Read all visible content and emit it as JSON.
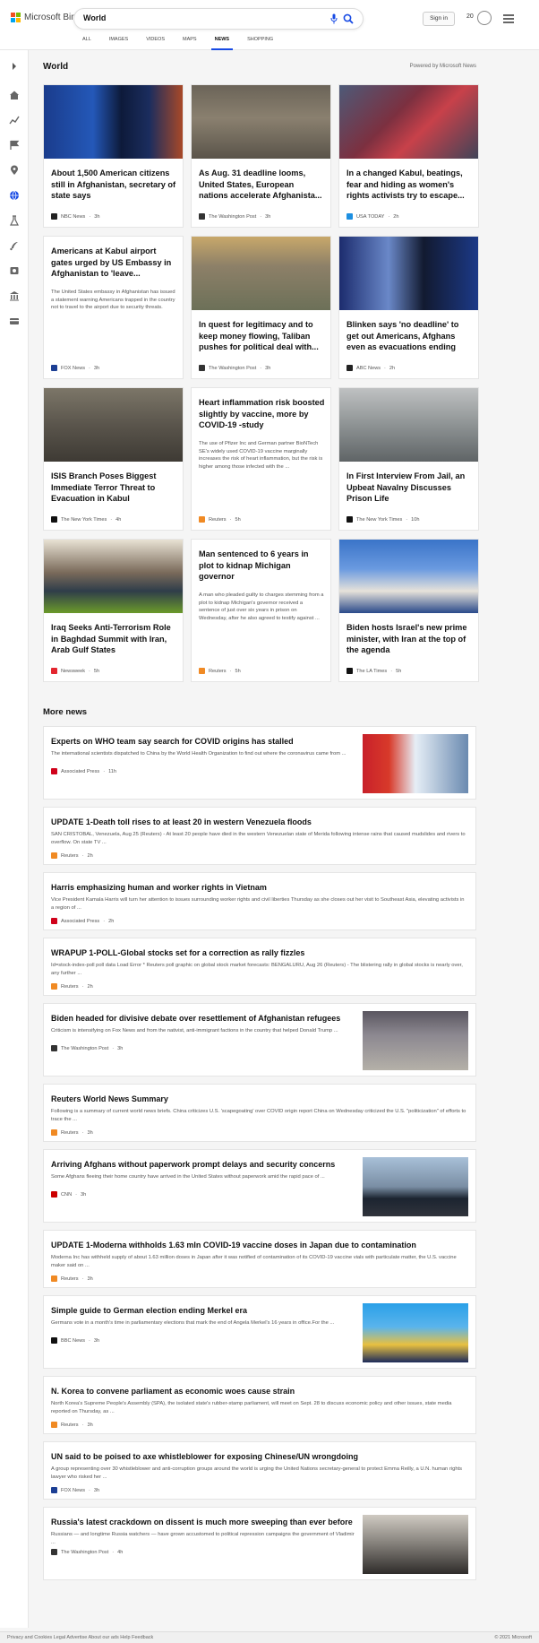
{
  "header": {
    "brand": "Microsoft Bing",
    "query": "World",
    "sign_in": "Sign in",
    "points": "20"
  },
  "tabs": [
    "ALL",
    "IMAGES",
    "VIDEOS",
    "MAPS",
    "NEWS",
    "SHOPPING"
  ],
  "active_tab": "NEWS",
  "section": {
    "title": "World",
    "powered_by": "Powered by Microsoft News"
  },
  "cards": [
    {
      "title": "About 1,500 American citizens still in Afghanistan, secretary of state says",
      "summary": "",
      "source": "NBC News",
      "time": "3h",
      "has_image": true,
      "src_color": "#222"
    },
    {
      "title": "As Aug. 31 deadline looms, United States, European nations accelerate Afghanista...",
      "summary": "",
      "source": "The Washington Post",
      "time": "3h",
      "has_image": true,
      "src_color": "#333"
    },
    {
      "title": "In a changed Kabul, beatings, fear and hiding as women's rights activists try to escape...",
      "summary": "",
      "source": "USA TODAY",
      "time": "2h",
      "has_image": true,
      "src_color": "#1d8fe1"
    },
    {
      "title": "Americans at Kabul airport gates urged by US Embassy in Afghanistan to 'leave...",
      "summary": "The United States embassy in Afghanistan has issued a statement warning Americans trapped in the country not to travel to the airport due to security threats.",
      "source": "FOX News",
      "time": "3h",
      "has_image": false,
      "src_color": "#1c3f94"
    },
    {
      "title": "In quest for legitimacy and to keep money flowing, Taliban pushes for political deal with...",
      "summary": "",
      "source": "The Washington Post",
      "time": "3h",
      "has_image": true,
      "src_color": "#333"
    },
    {
      "title": "Blinken says 'no deadline' to get out Americans, Afghans even as evacuations ending",
      "summary": "",
      "source": "ABC News",
      "time": "2h",
      "has_image": true,
      "src_color": "#222"
    },
    {
      "title": "ISIS Branch Poses Biggest Immediate Terror Threat to Evacuation in Kabul",
      "summary": "",
      "source": "The New York Times",
      "time": "4h",
      "has_image": true,
      "src_color": "#111"
    },
    {
      "title": "Heart inflammation risk boosted slightly by vaccine, more by COVID-19 -study",
      "summary": "The use of Pfizer Inc and German partner BioNTech SE's widely used COVID-19 vaccine marginally increases the risk of heart inflammation, but the risk is higher among those infected with the ...",
      "source": "Reuters",
      "time": "5h",
      "has_image": false,
      "src_color": "#f08a24"
    },
    {
      "title": "In First Interview From Jail, an Upbeat Navalny Discusses Prison Life",
      "summary": "",
      "source": "The New York Times",
      "time": "10h",
      "has_image": true,
      "src_color": "#111"
    },
    {
      "title": "Iraq Seeks Anti-Terrorism Role in Baghdad Summit with Iran, Arab Gulf States",
      "summary": "",
      "source": "Newsweek",
      "time": "5h",
      "has_image": true,
      "src_color": "#e3262f"
    },
    {
      "title": "Man sentenced to 6 years in plot to kidnap Michigan governor",
      "summary": "A man who pleaded guilty to charges stemming from a plot to kidnap Michigan's governor received a sentence of just over six years in prison on Wednesday, after he also agreed to testify against ...",
      "source": "Reuters",
      "time": "5h",
      "has_image": false,
      "src_color": "#f08a24"
    },
    {
      "title": "Biden hosts Israel's new prime minister, with Iran at the top of the agenda",
      "summary": "",
      "source": "The LA Times",
      "time": "5h",
      "has_image": true,
      "src_color": "#111"
    }
  ],
  "more_news": {
    "title": "More news",
    "items": [
      {
        "title": "Experts on WHO team say search for COVID origins has stalled",
        "summary": "The international scientists dispatched to China by the World Health Organization to find out where the coronavirus came from ...",
        "source": "Associated Press",
        "time": "11h",
        "has_image": true,
        "src_color": "#d0021b"
      },
      {
        "title": "UPDATE 1-Death toll rises to at least 20 in western Venezuela floods",
        "summary": "SAN CRISTOBAL, Venezuela, Aug 25 (Reuters) - At least 20 people have died in the western Venezuelan state of Merida following intense rains that caused mudslides and rivers to overflow. On state TV ...",
        "source": "Reuters",
        "time": "2h",
        "has_image": false,
        "src_color": "#f08a24"
      },
      {
        "title": "Harris emphasizing human and worker rights in Vietnam",
        "summary": "Vice President Kamala Harris will turn her attention to issues surrounding worker rights and civil liberties Thursday as she closes out her visit to Southeast Asia, elevating activists in a region of ...",
        "source": "Associated Press",
        "time": "2h",
        "has_image": false,
        "src_color": "#d0021b"
      },
      {
        "title": "WRAPUP 1-POLL-Global stocks set for a correction as rally fizzles",
        "summary": "Id=stock-index-poll poll data Load Error * Reuters poll graphic on global stock market forecasts: BENGALURU, Aug 26 (Reuters) - The blistering rally in global stocks is nearly over, any further ...",
        "source": "Reuters",
        "time": "2h",
        "has_image": false,
        "src_color": "#f08a24"
      },
      {
        "title": "Biden headed for divisive debate over resettlement of Afghanistan refugees",
        "summary": "Criticism is intensifying on Fox News and from the nativist, anti-immigrant factions in the country that helped Donald Trump ...",
        "source": "The Washington Post",
        "time": "3h",
        "has_image": true,
        "src_color": "#333"
      },
      {
        "title": "Reuters World News Summary",
        "summary": "Following is a summary of current world news briefs. China criticizes U.S. 'scapegoating' over COVID origin report China on Wednesday criticized the U.S. \"politicization\" of efforts to trace the ...",
        "source": "Reuters",
        "time": "3h",
        "has_image": false,
        "src_color": "#f08a24"
      },
      {
        "title": "Arriving Afghans without paperwork prompt delays and security concerns",
        "summary": "Some Afghans fleeing their home country have arrived in the United States without paperwork amid the rapid pace of ...",
        "source": "CNN",
        "time": "3h",
        "has_image": true,
        "src_color": "#cc0000"
      },
      {
        "title": "UPDATE 1-Moderna withholds 1.63 mln COVID-19 vaccine doses in Japan due to contamination",
        "summary": "Moderna Inc has withheld supply of about 1.63 million doses in Japan after it was notified of contamination of its COVID-19 vaccine vials with particulate matter, the U.S. vaccine maker said on ...",
        "source": "Reuters",
        "time": "3h",
        "has_image": false,
        "src_color": "#f08a24"
      },
      {
        "title": "Simple guide to German election ending Merkel era",
        "summary": "Germans vote in a month's time in parliamentary elections that mark the end of Angela Merkel's 16 years in office.For the ...",
        "source": "BBC News",
        "time": "3h",
        "has_image": true,
        "src_color": "#111"
      },
      {
        "title": "N. Korea to convene parliament as economic woes cause strain",
        "summary": "North Korea's Supreme People's Assembly (SPA), the isolated state's rubber-stamp parliament, will meet on Sept. 28 to discuss economic policy and other issues, state media reported on Thursday, as ...",
        "source": "Reuters",
        "time": "3h",
        "has_image": false,
        "src_color": "#f08a24"
      },
      {
        "title": "UN said to be poised to axe whistleblower for exposing Chinese/UN wrongdoing",
        "summary": "A group representing over 30 whistleblower and anti-corruption groups around the world is urging the United Nations secretary-general to protect Emma Reilly, a U.N. human rights lawyer who risked her ...",
        "source": "FOX News",
        "time": "3h",
        "has_image": false,
        "src_color": "#1c3f94"
      },
      {
        "title": "Russia's latest crackdown on dissent is much more sweeping than ever before",
        "summary": "Russians — and longtime Russia watchers — have grown accustomed to political repression campaigns the government of Vladimir ...",
        "source": "The Washington Post",
        "time": "4h",
        "has_image": true,
        "src_color": "#333"
      }
    ]
  },
  "footer": {
    "left": "Privacy and Cookies  Legal  Advertise  About our ads  Help  Feedback",
    "right": "© 2021 Microsoft"
  },
  "colors": {
    "accent": "#174ae4",
    "page_bg": "#f5f5f5"
  }
}
